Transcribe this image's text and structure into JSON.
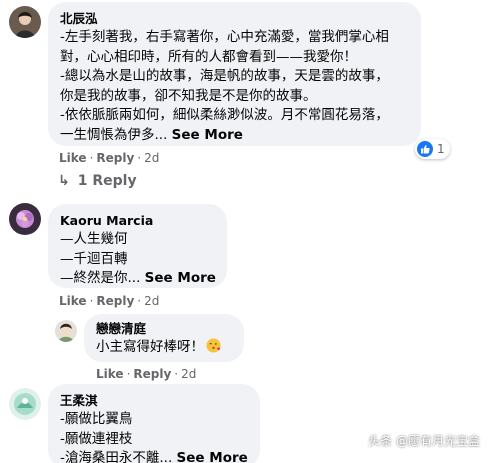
{
  "comments": [
    {
      "author": "北辰泓",
      "lines": [
        "-左手刻著我，右手寫著你，心中充滿愛，當我們掌心相",
        "對，心心相印時，所有的人都會看到——我愛你！",
        "-總以為水是山的故事，海是帆的故事，天是雲的故事，",
        "你是我的故事，卻不知我是不是你的故事。",
        "-依依脈脈兩如何，細似柔絲渺似波。月不常圓花易落，",
        "一生惆悵為伊多..."
      ],
      "see_more": "See More",
      "actions": {
        "like": "Like",
        "reply": "Reply",
        "time": "2d"
      },
      "reaction_count": "1",
      "replies_link": "1 Reply"
    },
    {
      "author": "Kaoru Marcia",
      "lines": [
        "—人生幾何",
        "—千迴百轉",
        "—終然是你..."
      ],
      "see_more": "See More",
      "actions": {
        "like": "Like",
        "reply": "Reply",
        "time": "2d"
      }
    },
    {
      "author": "戀戀清庭",
      "lines": [
        "小主寫得好棒呀！"
      ],
      "emoji": "kiss-emoji",
      "actions": {
        "like": "Like",
        "reply": "Reply",
        "time": "2d"
      }
    },
    {
      "author": "王柔淇",
      "lines": [
        "-願做比翼鳥",
        "-願做連裡枝",
        "-滄海桑田永不離..."
      ],
      "see_more": "See More"
    }
  ],
  "dot": "·",
  "watermark": "头条 @愿有月光宝盒",
  "colors": {
    "bubble": "#f0f2f5",
    "like_blue": "#1877f2",
    "meta_gray": "#65676b"
  }
}
